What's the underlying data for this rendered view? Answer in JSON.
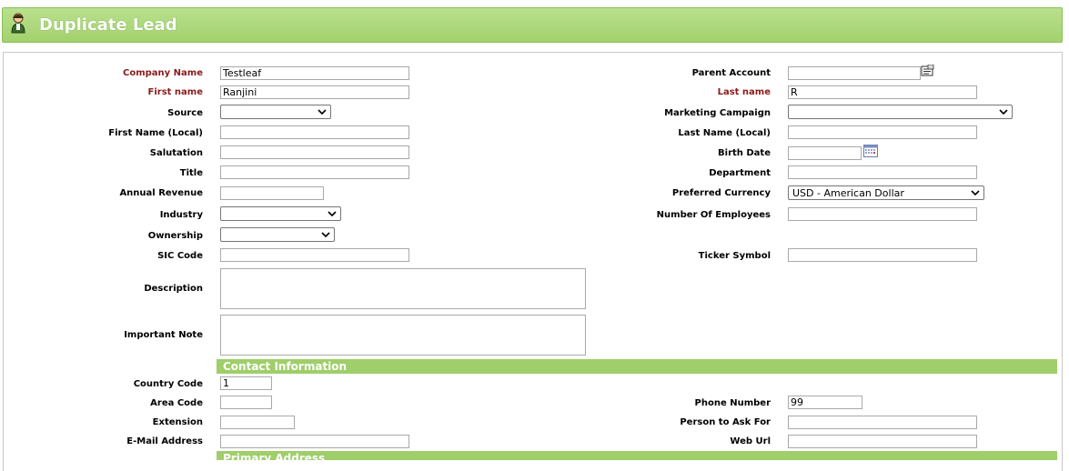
{
  "header": {
    "title": "Duplicate Lead"
  },
  "colors": {
    "header_green": "#a3d16d",
    "required_label": "#8b1a1a",
    "section_green": "#9fce6a"
  },
  "form": {
    "company_name": {
      "label": "Company Name",
      "value": "Testleaf"
    },
    "parent_account": {
      "label": "Parent Account",
      "value": ""
    },
    "first_name": {
      "label": "First name",
      "value": "Ranjini"
    },
    "last_name": {
      "label": "Last name",
      "value": "R"
    },
    "source": {
      "label": "Source",
      "value": ""
    },
    "marketing_campaign": {
      "label": "Marketing Campaign",
      "value": ""
    },
    "first_name_local": {
      "label": "First Name (Local)",
      "value": ""
    },
    "last_name_local": {
      "label": "Last Name (Local)",
      "value": ""
    },
    "salutation": {
      "label": "Salutation",
      "value": ""
    },
    "birth_date": {
      "label": "Birth Date",
      "value": ""
    },
    "title": {
      "label": "Title",
      "value": ""
    },
    "department": {
      "label": "Department",
      "value": ""
    },
    "annual_revenue": {
      "label": "Annual Revenue",
      "value": ""
    },
    "preferred_currency": {
      "label": "Preferred Currency",
      "value": "USD - American Dollar"
    },
    "industry": {
      "label": "Industry",
      "value": ""
    },
    "number_of_employees": {
      "label": "Number Of Employees",
      "value": ""
    },
    "ownership": {
      "label": "Ownership",
      "value": ""
    },
    "sic_code": {
      "label": "SIC Code",
      "value": ""
    },
    "ticker_symbol": {
      "label": "Ticker Symbol",
      "value": ""
    },
    "description": {
      "label": "Description",
      "value": ""
    },
    "important_note": {
      "label": "Important Note",
      "value": ""
    }
  },
  "sections": {
    "contact": "Contact Information",
    "primary_address": "Primary Address"
  },
  "contact": {
    "country_code": {
      "label": "Country Code",
      "value": "1"
    },
    "area_code": {
      "label": "Area Code",
      "value": ""
    },
    "phone_number": {
      "label": "Phone Number",
      "value": "99"
    },
    "extension": {
      "label": "Extension",
      "value": ""
    },
    "person_to_ask_for": {
      "label": "Person to Ask For",
      "value": ""
    },
    "email_address": {
      "label": "E-Mail Address",
      "value": ""
    },
    "web_url": {
      "label": "Web Url",
      "value": ""
    }
  },
  "icons": {
    "header": "user-icon",
    "parent_lookup": "lookup-icon",
    "birth_date": "calendar-icon",
    "dropdown": "chevron-down-icon"
  }
}
